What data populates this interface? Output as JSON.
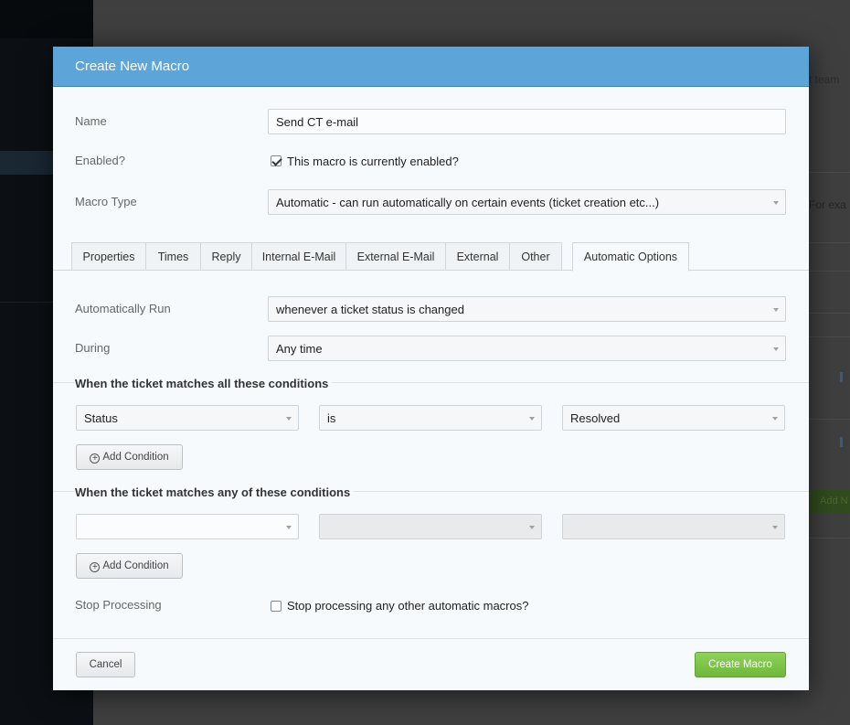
{
  "background": {
    "partial_text_1": "t team",
    "partial_text_2": "For exa",
    "partial_button": "Add N"
  },
  "modal": {
    "title": "Create New Macro"
  },
  "form": {
    "name_label": "Name",
    "name_value": "Send CT e-mail",
    "enabled_label": "Enabled?",
    "enabled_checked": true,
    "enabled_text": "This macro is currently enabled?",
    "type_label": "Macro Type",
    "type_value": "Automatic - can run automatically on certain events (ticket creation etc...)"
  },
  "tabs": [
    {
      "label": "Properties"
    },
    {
      "label": "Times"
    },
    {
      "label": "Reply"
    },
    {
      "label": "Internal E-Mail"
    },
    {
      "label": "External E-Mail"
    },
    {
      "label": "External"
    },
    {
      "label": "Other"
    },
    {
      "label": "Automatic Options",
      "active": true
    }
  ],
  "automatic": {
    "run_label": "Automatically Run",
    "run_value": "whenever a ticket status is changed",
    "during_label": "During",
    "during_value": "Any time",
    "all_heading": "When the ticket matches all these conditions",
    "all_condition": {
      "field": "Status",
      "operator": "is",
      "value": "Resolved"
    },
    "any_heading": "When the ticket matches any of these conditions",
    "any_condition": {
      "field": "",
      "operator": "",
      "value": ""
    },
    "add_condition": "Add Condition",
    "stop_label": "Stop Processing",
    "stop_checked": false,
    "stop_text": "Stop processing any other automatic macros?"
  },
  "footer": {
    "cancel": "Cancel",
    "create": "Create Macro"
  },
  "colors": {
    "header": "#5da5d9",
    "primary_button": "#7cc348"
  }
}
